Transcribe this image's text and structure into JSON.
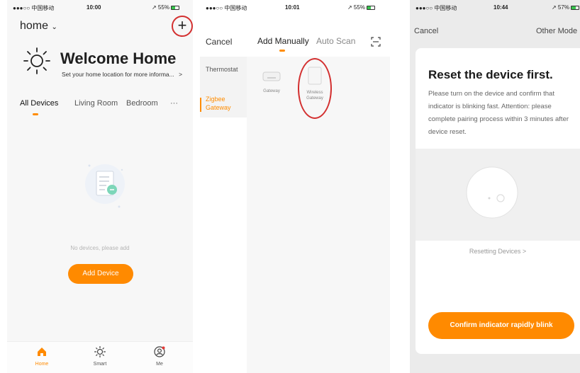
{
  "screen1": {
    "status": {
      "carrier": "●●●○○ 中国移动",
      "time": "10:00",
      "battery": "↗ 55%",
      "battery_level": 0.55
    },
    "home_label": "home",
    "add_label": "+",
    "welcome": "Welcome Home",
    "subtext": "Set your home location for more informa...",
    "subtext_chevron": ">",
    "tabs": [
      "All Devices",
      "Living Room",
      "Bedroom",
      "···"
    ],
    "empty_text": "No devices, please add",
    "add_device": "Add Device",
    "tabbar": [
      {
        "label": "Home"
      },
      {
        "label": "Smart"
      },
      {
        "label": "Me"
      }
    ],
    "accent_color": "#ff8a00"
  },
  "screen2": {
    "status": {
      "carrier": "●●●○○ 中国移动",
      "time": "10:01",
      "battery": "↗ 55%",
      "battery_level": 0.55
    },
    "cancel": "Cancel",
    "tabs": [
      "Add Manually",
      "Auto Scan"
    ],
    "sidebar": [
      {
        "label": "Thermostat"
      },
      {
        "label": "Zigbee Gateway"
      }
    ],
    "devices": [
      {
        "label": "Gateway"
      },
      {
        "label": "Wireless Gateway"
      }
    ]
  },
  "screen3": {
    "status": {
      "carrier": "●●●○○ 中国移动",
      "time": "10:44",
      "battery": "↗ 57%",
      "battery_level": 0.57
    },
    "cancel": "Cancel",
    "other": "Other Mode",
    "title": "Reset the device first.",
    "body": "Please turn on the device and confirm that indicator is blinking fast. Attention: please complete pairing process within 3 minutes after device reset.",
    "resetting": "Resetting Devices >",
    "confirm": "Confirm indicator rapidly blink"
  }
}
